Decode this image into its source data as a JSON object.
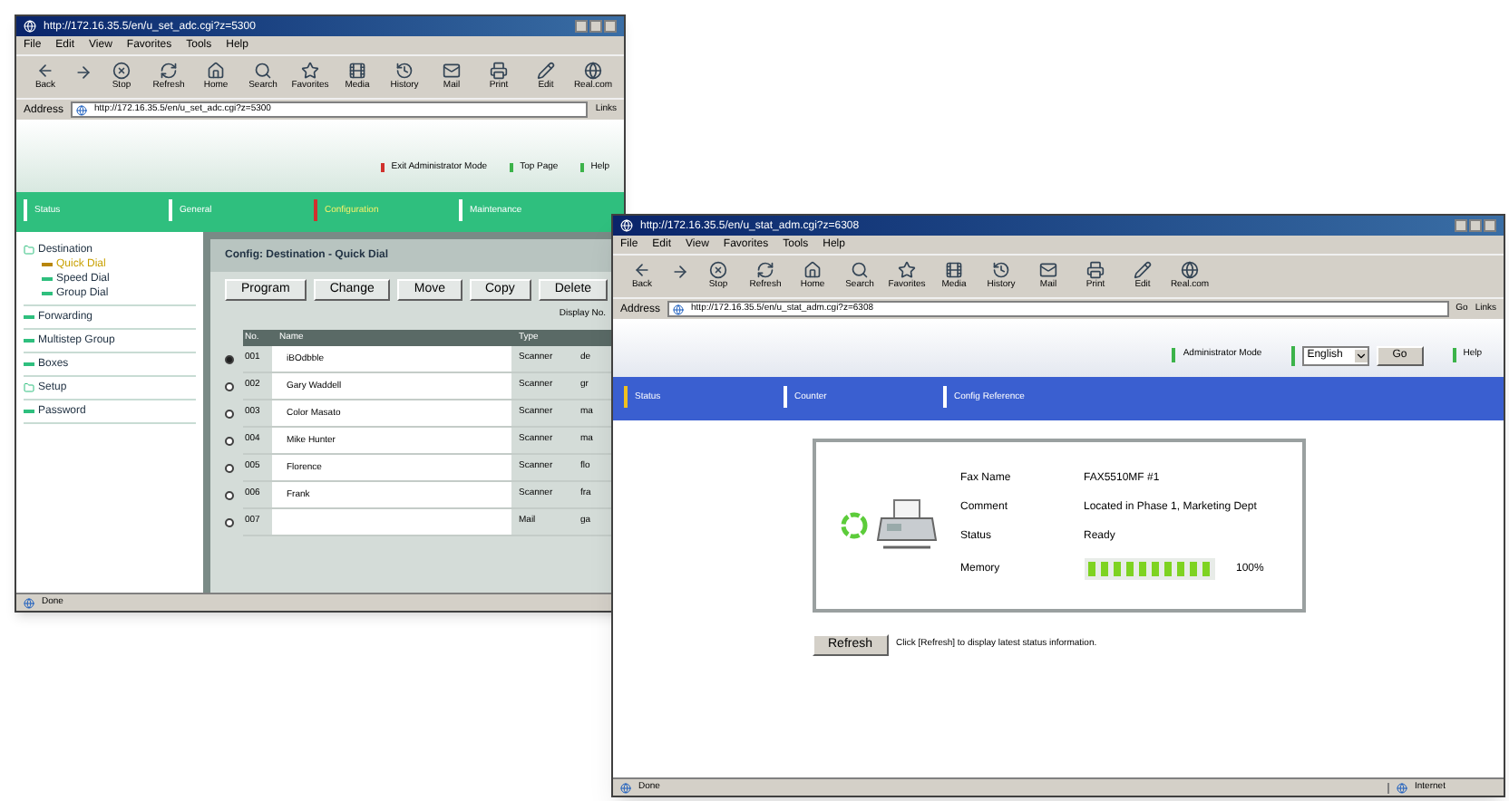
{
  "back_window": {
    "title": "http://172.16.35.5/en/u_set_adc.cgi?z=5300",
    "menu": [
      "File",
      "Edit",
      "View",
      "Favorites",
      "Tools",
      "Help"
    ],
    "toolbar": [
      "Back",
      "Stop",
      "Refresh",
      "Home",
      "Search",
      "Favorites",
      "Media",
      "History",
      "Mail",
      "Print",
      "Edit",
      "Real.com"
    ],
    "address_label": "Address",
    "address": "http://172.16.35.5/en/u_set_adc.cgi?z=5300",
    "links_label": "Links",
    "header_links": [
      {
        "label": "Exit Administrator Mode",
        "color": "#d0312d"
      },
      {
        "label": "Top Page",
        "color": "#3cb34a"
      },
      {
        "label": "Help",
        "color": "#3cb34a"
      }
    ],
    "tabs": [
      {
        "label": "Status",
        "selected": false
      },
      {
        "label": "General",
        "selected": false
      },
      {
        "label": "Configuration",
        "selected": true
      },
      {
        "label": "Maintenance",
        "selected": false
      }
    ],
    "sidebar": [
      {
        "label": "Destination",
        "expanded": true,
        "children": [
          {
            "label": "Quick Dial",
            "selected": true
          },
          {
            "label": "Speed Dial",
            "selected": false
          },
          {
            "label": "Group Dial",
            "selected": false
          }
        ]
      },
      {
        "label": "Forwarding",
        "expanded": false
      },
      {
        "label": "Multistep Group",
        "expanded": false
      },
      {
        "label": "Boxes",
        "expanded": false
      },
      {
        "label": "Setup",
        "expanded": true
      },
      {
        "label": "Password",
        "expanded": false
      }
    ],
    "panel_title": "Config: Destination - Quick Dial",
    "buttons": [
      "Program",
      "Change",
      "Move",
      "Copy",
      "Delete"
    ],
    "display_label": "Display No.",
    "columns": [
      "No.",
      "Name",
      "Type"
    ],
    "rows": [
      {
        "no": "001",
        "name": "iBOdbble",
        "type": "Scanner",
        "column_4": "de",
        "selected": true
      },
      {
        "no": "002",
        "name": "Gary Waddell",
        "type": "Scanner",
        "column_4": "gr",
        "selected": false
      },
      {
        "no": "003",
        "name": "Color Masato",
        "type": "Scanner",
        "column_4": "ma",
        "selected": false
      },
      {
        "no": "004",
        "name": "Mike Hunter",
        "type": "Scanner",
        "column_4": "ma",
        "selected": false
      },
      {
        "no": "005",
        "name": "Florence",
        "type": "Scanner",
        "column_4": "flo",
        "selected": false
      },
      {
        "no": "006",
        "name": "Frank",
        "type": "Scanner",
        "column_4": "fra",
        "selected": false
      },
      {
        "no": "007",
        "type": "Mail",
        "column_4": "ga",
        "selected": false
      }
    ],
    "status": "Done"
  },
  "front_window": {
    "title": "http://172.16.35.5/en/u_stat_adm.cgi?z=6308",
    "menu": [
      "File",
      "Edit",
      "View",
      "Favorites",
      "Tools",
      "Help"
    ],
    "toolbar": [
      "Back",
      "Stop",
      "Refresh",
      "Home",
      "Search",
      "Favorites",
      "Media",
      "History",
      "Mail",
      "Print",
      "Edit",
      "Real.com"
    ],
    "address_label": "Address",
    "address": "http://172.16.35.5/en/u_stat_adm.cgi?z=6308",
    "go_label": "Go",
    "links_label": "Links",
    "admin_link": "Administrator Mode",
    "language": "English",
    "go_button": "Go",
    "help_link": "Help",
    "tabs": [
      {
        "label": "Status",
        "selected": true
      },
      {
        "label": "Counter",
        "selected": false
      },
      {
        "label": "Config Reference",
        "selected": false
      }
    ],
    "fields": [
      {
        "label": "Fax Name",
        "value": "FAX5510MF #1"
      },
      {
        "label": "Comment",
        "value": "Located in Phase 1, Marketing Dept"
      },
      {
        "label": "Status",
        "value": "Ready"
      }
    ],
    "memory": {
      "label": "Memory",
      "level": 1.0,
      "reading": "100%"
    },
    "refresh_button": "Refresh",
    "refresh_hint": "Click [Refresh] to display latest status information.",
    "status": "Done",
    "zone": "Internet"
  }
}
